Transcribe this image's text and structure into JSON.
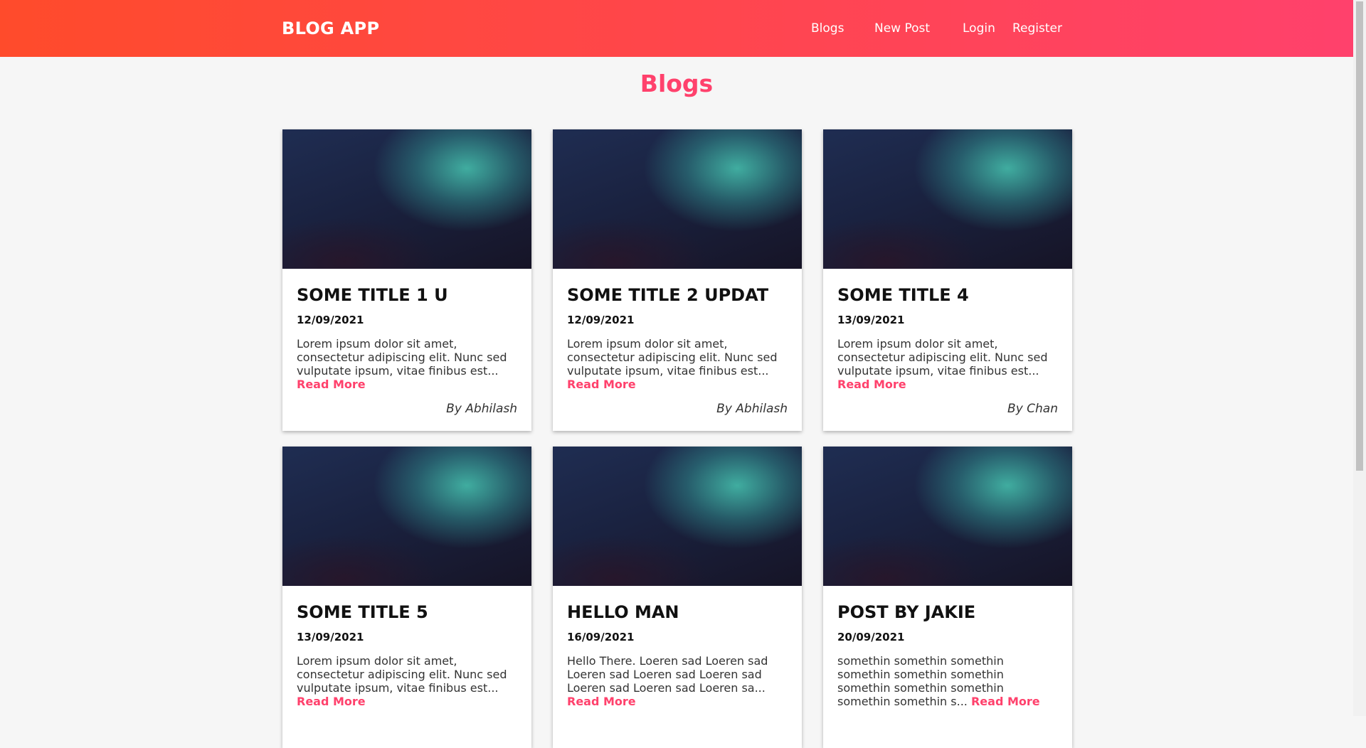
{
  "nav": {
    "brand": "BLOG APP",
    "links": [
      "Blogs",
      "New Post",
      "Login",
      "Register"
    ]
  },
  "page_title": "Blogs",
  "posts": [
    {
      "title": "SOME TITLE 1 U",
      "date": "12/09/2021",
      "excerpt": "Lorem ipsum dolor sit amet, consectetur adipiscing elit. Nunc sed vulputate ipsum, vitae finibus est...",
      "read_more": "Read More",
      "author": "By Abhilash"
    },
    {
      "title": "SOME TITLE 2 UPDAT",
      "date": "12/09/2021",
      "excerpt": "Lorem ipsum dolor sit amet, consectetur adipiscing elit. Nunc sed vulputate ipsum, vitae finibus est...",
      "read_more": "Read More",
      "author": "By Abhilash"
    },
    {
      "title": "SOME TITLE 4",
      "date": "13/09/2021",
      "excerpt": "Lorem ipsum dolor sit amet, consectetur adipiscing elit. Nunc sed vulputate ipsum, vitae finibus est...",
      "read_more": "Read More",
      "author": "By Chan"
    },
    {
      "title": "SOME TITLE 5",
      "date": "13/09/2021",
      "excerpt": "Lorem ipsum dolor sit amet, consectetur adipiscing elit. Nunc sed vulputate ipsum, vitae finibus est...",
      "read_more": "Read More",
      "author": ""
    },
    {
      "title": "HELLO MAN",
      "date": "16/09/2021",
      "excerpt": "Hello There. Loeren sad Loeren sad Loeren sad Loeren sad Loeren sad Loeren sad Loeren sad Loeren sa...",
      "read_more": "Read More",
      "author": ""
    },
    {
      "title": "POST BY JAKIE",
      "date": "20/09/2021",
      "excerpt": "somethin somethin somethin somethin somethin somethin somethin somethin somethin somethin somethin s...",
      "read_more": "Read More",
      "author": ""
    }
  ],
  "colors": {
    "nav_gradient_start": "#ff4b2b",
    "nav_gradient_end": "#ff416c",
    "accent": "#ff416c",
    "background": "#f6f6f6"
  }
}
